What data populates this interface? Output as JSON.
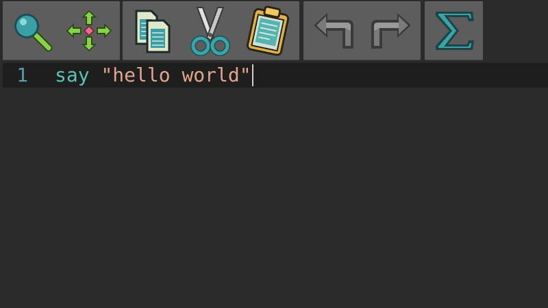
{
  "toolbar": {
    "groups": [
      {
        "name": "navigation",
        "tools": [
          {
            "icon": "magnifier-icon"
          },
          {
            "icon": "move-arrows-icon"
          }
        ]
      },
      {
        "name": "clipboard",
        "tools": [
          {
            "icon": "copy-pages-icon"
          },
          {
            "icon": "scissors-icon"
          },
          {
            "icon": "clipboard-icon"
          }
        ]
      },
      {
        "name": "history",
        "tools": [
          {
            "icon": "undo-arrow-icon"
          },
          {
            "icon": "redo-arrow-icon"
          }
        ]
      },
      {
        "name": "math",
        "tools": [
          {
            "icon": "sigma-icon"
          }
        ]
      }
    ],
    "colors": {
      "group_bg": "#5d5d5d",
      "teal": "#3aa5a8",
      "green": "#8fd14f",
      "gray_arrow": "#707070"
    }
  },
  "editor": {
    "lines": [
      {
        "number": "1",
        "tokens": {
          "keyword": "say",
          "space": " ",
          "string": "\"hello world\""
        }
      }
    ],
    "colors": {
      "background": "#2b2b2b",
      "current_line": "#1e1e1e",
      "line_number": "#5a9ab0",
      "keyword": "#58c4b6",
      "string": "#e3a58d"
    }
  }
}
